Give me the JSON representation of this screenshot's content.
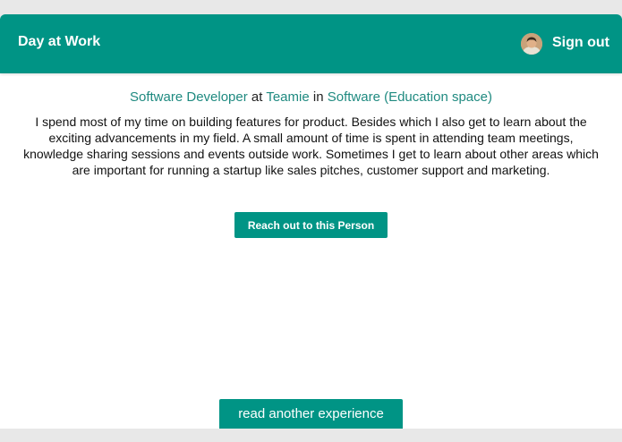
{
  "header": {
    "brand": "Day at Work",
    "sign_out_label": "Sign out",
    "avatar_icon": "user-avatar-icon",
    "background_color": "#009485"
  },
  "experience": {
    "role": "Software Developer",
    "at_word": "at",
    "company": "Teamie",
    "in_word": "in",
    "industry": "Software (Education space)",
    "description": "I spend most of my time on building features for product. Besides which I also get to learn about the exciting advancements in my field. A small amount of time is spent in attending team meetings, knowledge sharing sessions and events outside work. Sometimes I get to learn about other areas which are important for running a startup like sales pitches, customer support and marketing.",
    "reach_out_label": "Reach out to this Person",
    "link_color": "#1f8a80"
  },
  "footer": {
    "read_another_label": "read another experience"
  }
}
